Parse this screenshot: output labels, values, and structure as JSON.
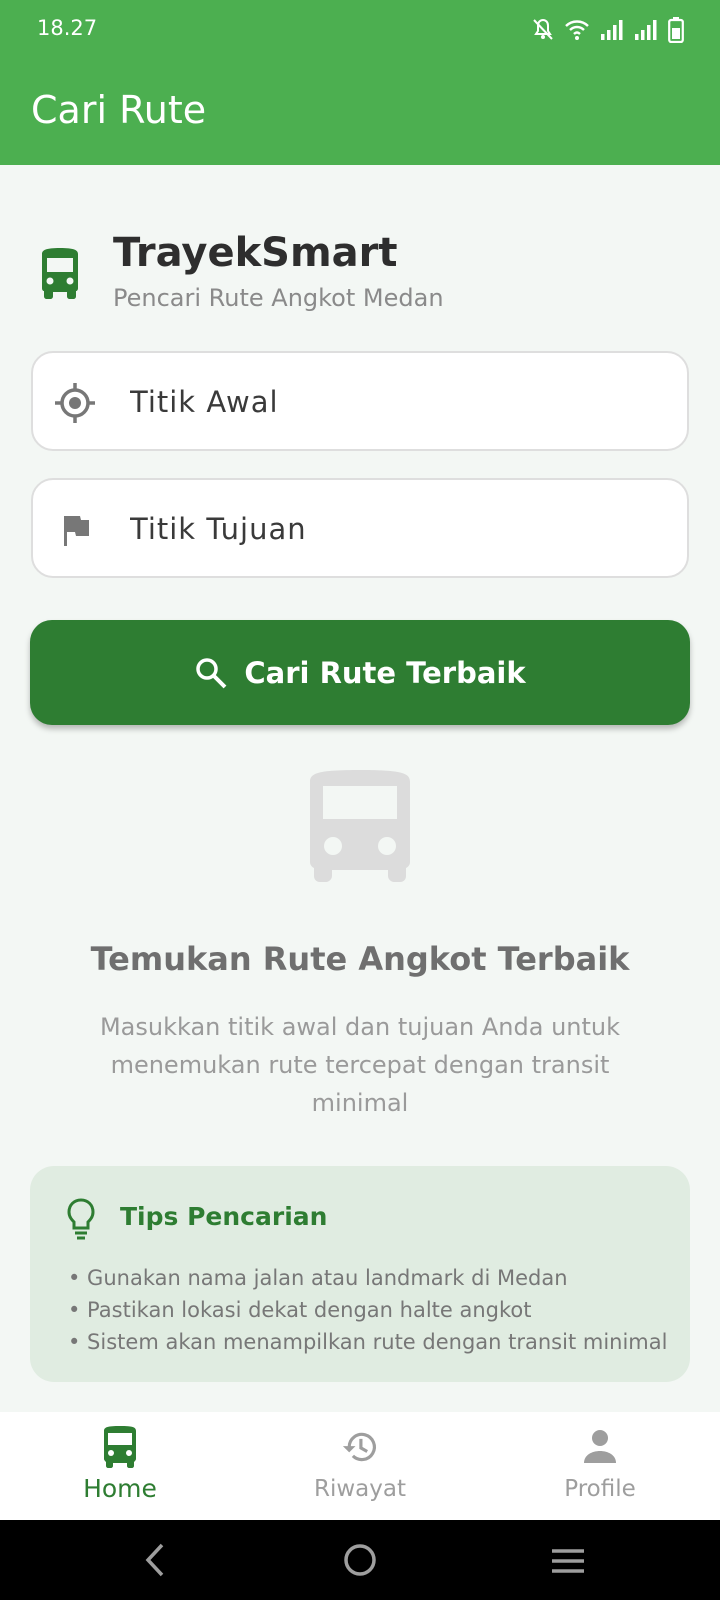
{
  "status_bar": {
    "time": "18.27"
  },
  "app_bar": {
    "title": "Cari Rute"
  },
  "brand": {
    "name": "TrayekSmart",
    "subtitle": "Pencari Rute Angkot Medan"
  },
  "form": {
    "origin_placeholder": "Titik Awal",
    "destination_placeholder": "Titik Tujuan",
    "search_button": "Cari Rute Terbaik"
  },
  "empty_state": {
    "title": "Temukan Rute Angkot Terbaik",
    "description": "Masukkan titik awal dan tujuan Anda untuk menemukan rute tercepat dengan transit minimal"
  },
  "tips": {
    "title": "Tips Pencarian",
    "items": [
      "• Gunakan nama jalan atau landmark di Medan",
      "• Pastikan lokasi dekat dengan halte angkot",
      "• Sistem akan menampilkan rute dengan transit minimal"
    ]
  },
  "bottom_nav": {
    "items": [
      {
        "label": "Home",
        "icon": "bus-icon",
        "active": true
      },
      {
        "label": "Riwayat",
        "icon": "history-icon",
        "active": false
      },
      {
        "label": "Profile",
        "icon": "person-icon",
        "active": false
      }
    ]
  },
  "colors": {
    "primary": "#4caf50",
    "primary_dark": "#2e7d32",
    "background": "#f3f7f4",
    "tips_background": "#e0ece1"
  }
}
